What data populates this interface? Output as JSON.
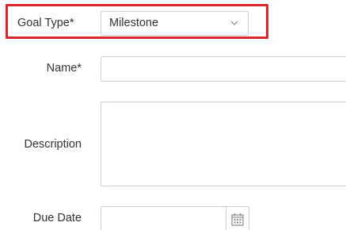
{
  "form": {
    "goal_type": {
      "label": "Goal Type*",
      "selected": "Milestone",
      "icon": "chevron-down-icon"
    },
    "name": {
      "label": "Name*",
      "value": ""
    },
    "description": {
      "label": "Description",
      "value": ""
    },
    "due_date": {
      "label": "Due Date",
      "value": "",
      "icon": "calendar-icon"
    }
  },
  "colors": {
    "highlight": "#d9262f",
    "border": "#cfcfcf",
    "text": "#333333"
  }
}
